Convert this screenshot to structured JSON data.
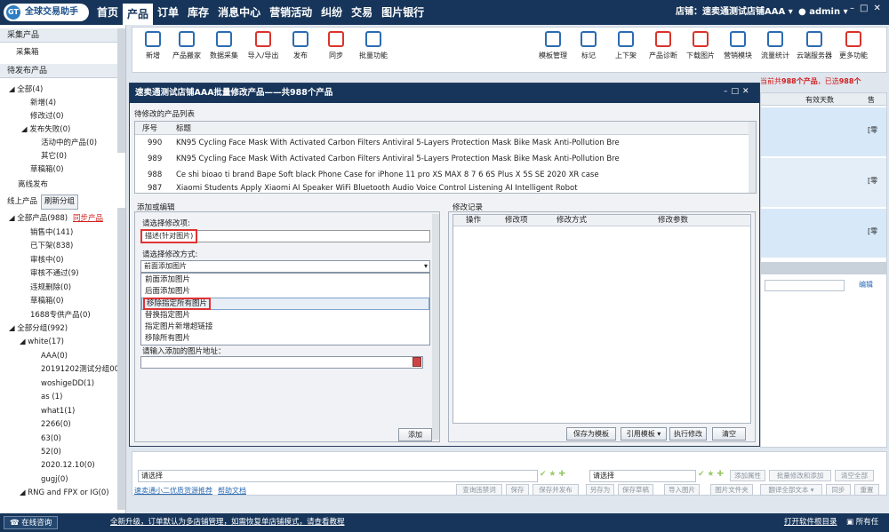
{
  "app": {
    "logo_text": "全球交易助手",
    "nav": [
      "首页",
      "产品",
      "订单",
      "库存",
      "消息中心",
      "营销活动",
      "纠纷",
      "交易",
      "图片银行"
    ],
    "shop": "店铺：速卖通测试店铺AAA ▾",
    "user": "admin ▾"
  },
  "left": {
    "collect_header": "采集产品",
    "collect_box": "采集箱",
    "pending_header": "待发布产品",
    "pending_items": [
      "全部(4)",
      "新增(4)",
      "修改过(0)",
      "发布失败(0)",
      "活动中的产品(0)",
      "其它(0)",
      "草稿箱(0)"
    ],
    "offline": "离线发布",
    "online_tab": "线上产品",
    "refresh_tab": "刷新分组",
    "online_all": "全部产品(988)",
    "sync": "同步产品",
    "online_items": [
      "销售中(141)",
      "已下架(838)",
      "审核中(0)",
      "审核不通过(9)",
      "违规删除(0)",
      "草稿箱(0)",
      "1688专供产品(0)"
    ],
    "groups_all": "全部分组(992)",
    "group_white": "white(17)",
    "groups": [
      "AAA(0)",
      "20191202测试分组00'",
      "woshigeDD(1)",
      "as (1)",
      "what1(1)",
      "2266(0)",
      "63(0)",
      "52(0)",
      "2020.12.10(0)",
      "gugj(0)"
    ],
    "group_rng": "RNG and FPX or IG(0)"
  },
  "toolbar": {
    "left": [
      "新增",
      "产品搬家",
      "数据采集",
      "导入/导出",
      "发布",
      "同步",
      "批量功能"
    ],
    "right": [
      "模板管理",
      "标记",
      "上下架",
      "产品诊断",
      "下载图片",
      "营销模块",
      "流量统计",
      "云端服务器",
      "更多功能"
    ]
  },
  "bg": {
    "count_prefix": "当前共",
    "count": "988个产品",
    "count_mid": "，已选",
    "selected": "988个",
    "col_valid": "有效天数",
    "col_sale": "售",
    "zero": "[零",
    "edit": "编辑"
  },
  "dialog": {
    "title": "速卖通测试店铺AAA批量修改产品——共988个产品",
    "list_label": "待修改的产品列表",
    "cols": [
      "序号",
      "标题"
    ],
    "products": [
      {
        "no": "990",
        "title": "KN95 Cycling Face Mask With Activated Carbon Filters Antiviral 5-Layers Protection Mask Bike Mask Anti-Pollution Bre"
      },
      {
        "no": "989",
        "title": "KN95 Cycling Face Mask With Activated Carbon Filters Antiviral 5-Layers Protection Mask Bike Mask Anti-Pollution Bre"
      },
      {
        "no": "988",
        "title": "Ce shi bioao ti brand Bape Soft black Phone Case for iPhone 11 pro XS MAX 8 7 6 6S Plus X 5S SE 2020 XR case"
      },
      {
        "no": "987",
        "title": "Xiaomi Students Apply Xiaomi AI Speaker WiFi Bluetooth Audio Voice Control Listening AI Intelligent Robot"
      }
    ],
    "edit_group": "添加或编辑",
    "item_label": "请选择修改项:",
    "item_value": "描述(针对图片)",
    "mode_label": "请选择修改方式:",
    "mode_value": "前面添加图片",
    "options": [
      "前面添加图片",
      "后面添加图片",
      "移除指定所有图片",
      "替换指定图片",
      "指定图片新增超链接",
      "移除所有图片"
    ],
    "url_label": "请输入添加的图片地址：",
    "add_btn": "添加",
    "record_group": "修改记录",
    "record_cols": [
      "操作",
      "修改项",
      "修改方式",
      "修改参数"
    ],
    "save_tpl": "保存为模板",
    "cite_tpl": "引用模板 ▾",
    "run": "执行修改",
    "clear": "清空"
  },
  "bottom": {
    "choose": "请选择",
    "links": [
      "速卖通小二优质货源推荐",
      "帮助文档"
    ],
    "buttons": [
      "查询违禁词",
      "保存",
      "保存并发布",
      "另存为",
      "保存草稿",
      "导入图片",
      "图片文件夹",
      "翻译全部文本 ▾",
      "同步",
      "重置"
    ],
    "right_buttons": [
      "添加属性",
      "批量修改和添加",
      "清空全部"
    ]
  },
  "status": {
    "online": "在线咨询",
    "notice": "全新升级，订单默认为多店铺管理，如需恢复单店铺模式，请查看教程",
    "open_dir": "打开软件根目录",
    "tasks": "所有任"
  }
}
